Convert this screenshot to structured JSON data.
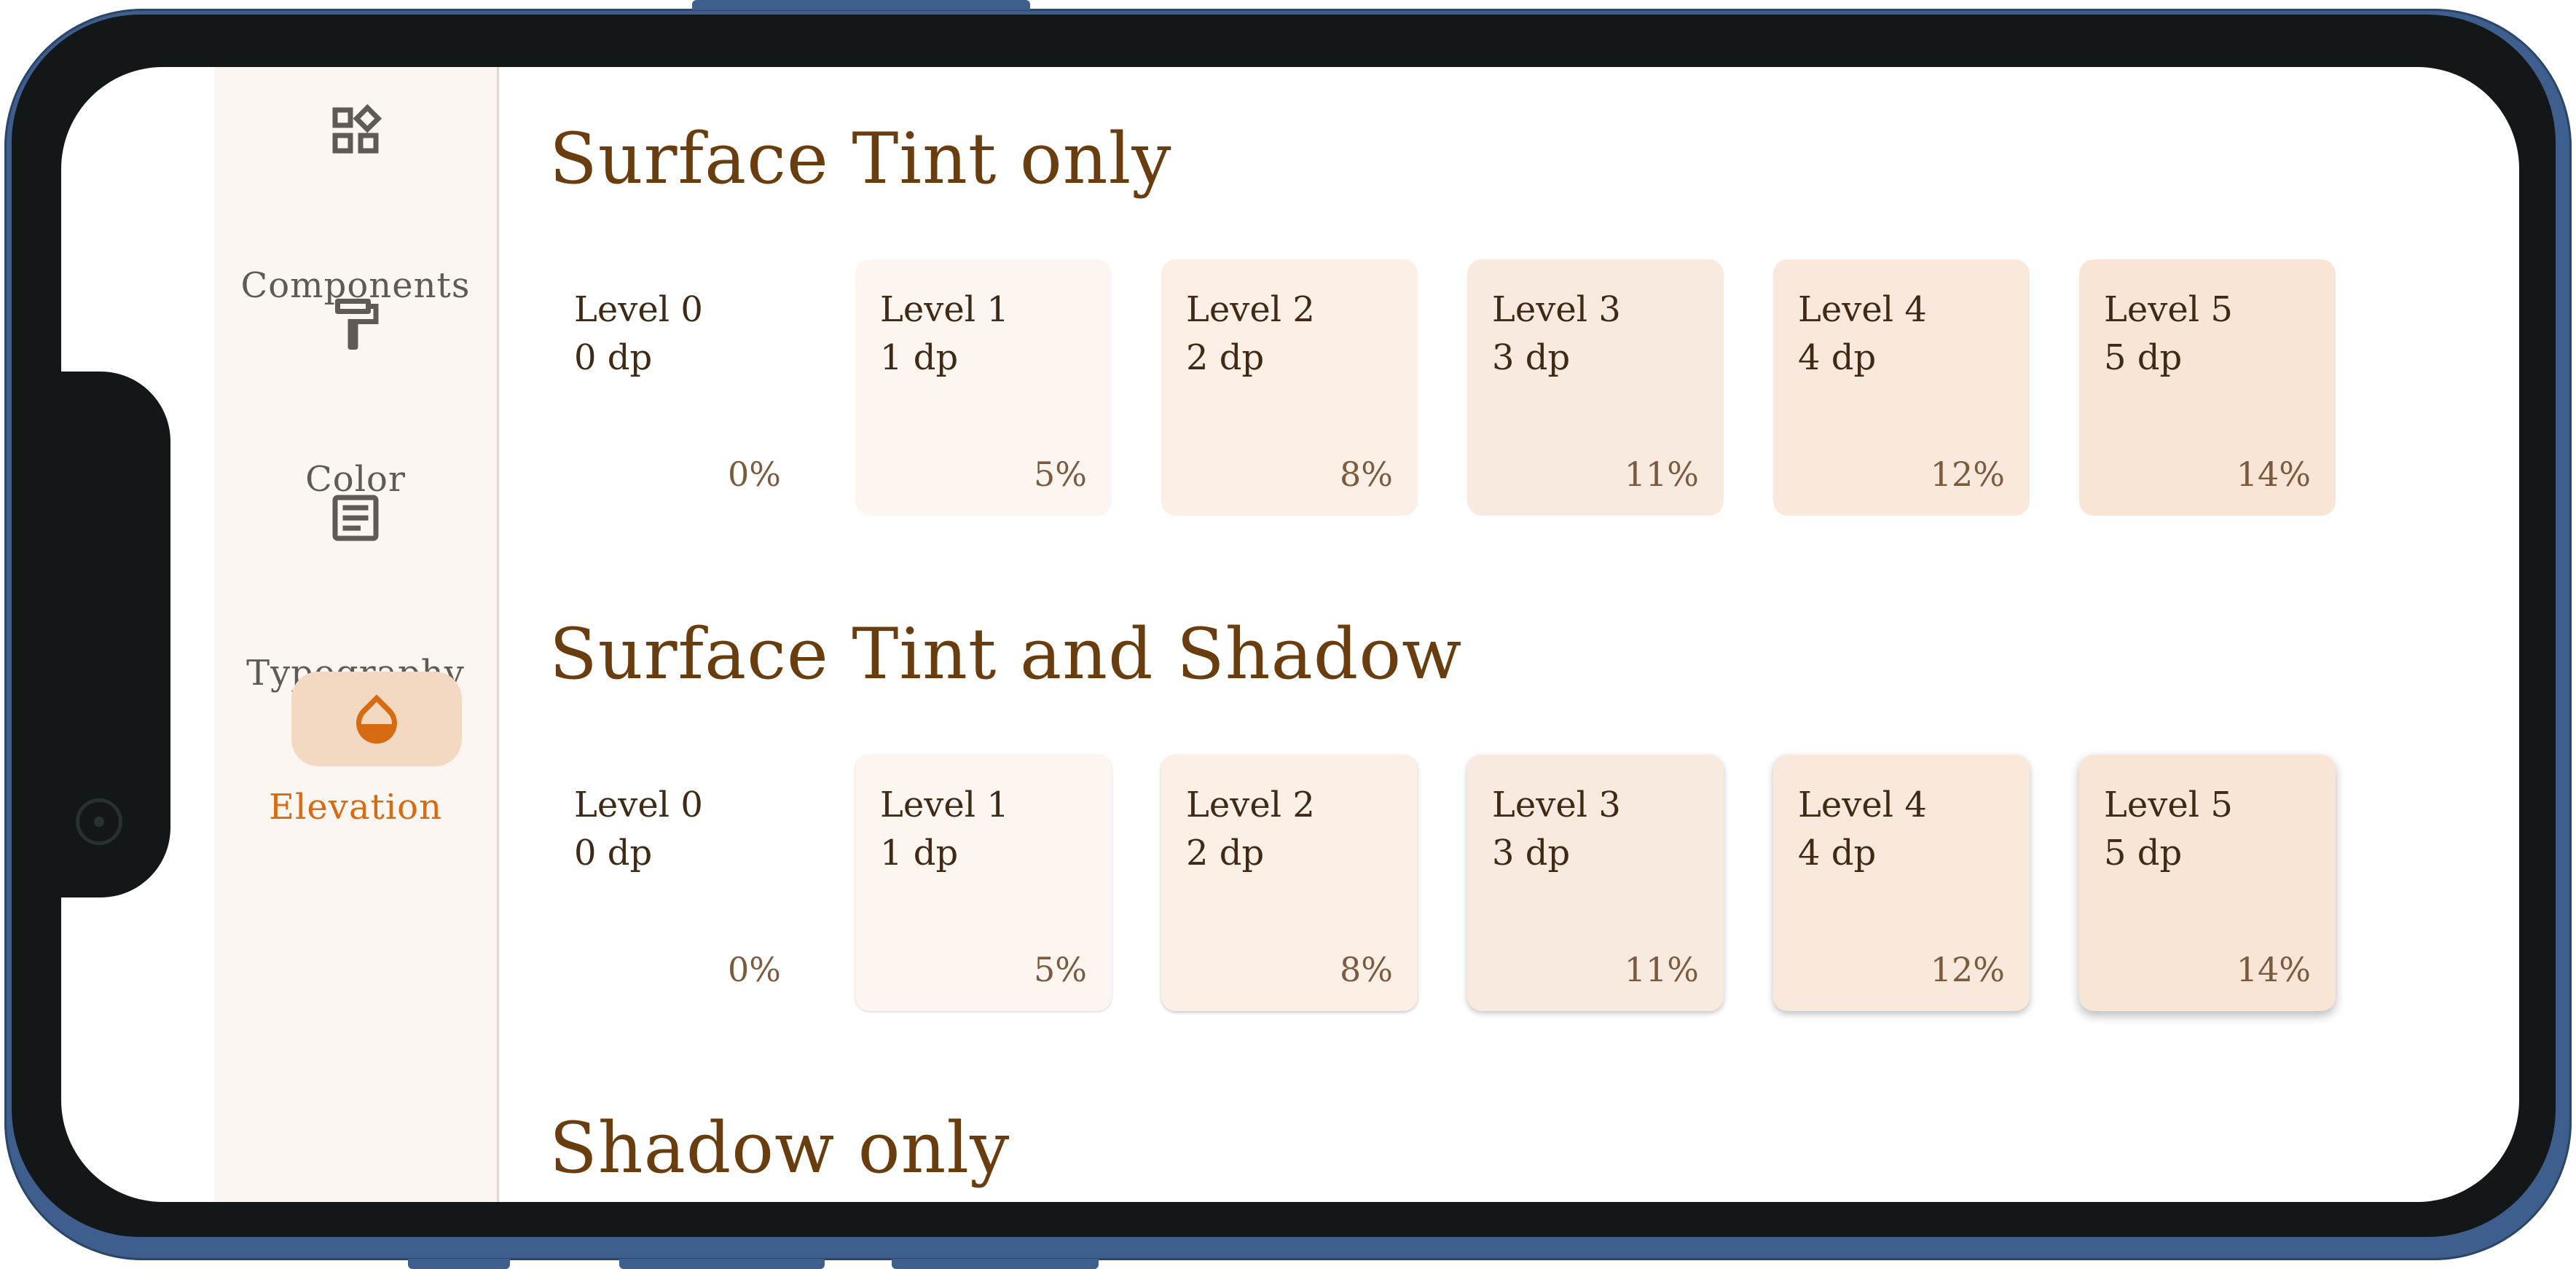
{
  "nav": {
    "items": [
      {
        "label": "Components",
        "icon": "widgets-icon",
        "active": false
      },
      {
        "label": "Color",
        "icon": "format-paint-icon",
        "active": false
      },
      {
        "label": "Typography",
        "icon": "article-icon",
        "active": false
      },
      {
        "label": "Elevation",
        "icon": "opacity-icon",
        "active": true
      }
    ]
  },
  "sections": [
    {
      "title": "Surface Tint only",
      "cards": [
        {
          "level": "Level 0",
          "dp": "0 dp",
          "pct": "0%"
        },
        {
          "level": "Level 1",
          "dp": "1 dp",
          "pct": "5%"
        },
        {
          "level": "Level 2",
          "dp": "2 dp",
          "pct": "8%"
        },
        {
          "level": "Level 3",
          "dp": "3 dp",
          "pct": "11%"
        },
        {
          "level": "Level 4",
          "dp": "4 dp",
          "pct": "12%"
        },
        {
          "level": "Level 5",
          "dp": "5 dp",
          "pct": "14%"
        }
      ]
    },
    {
      "title": "Surface Tint and Shadow",
      "cards": [
        {
          "level": "Level 0",
          "dp": "0 dp",
          "pct": "0%"
        },
        {
          "level": "Level 1",
          "dp": "1 dp",
          "pct": "5%"
        },
        {
          "level": "Level 2",
          "dp": "2 dp",
          "pct": "8%"
        },
        {
          "level": "Level 3",
          "dp": "3 dp",
          "pct": "11%"
        },
        {
          "level": "Level 4",
          "dp": "4 dp",
          "pct": "12%"
        },
        {
          "level": "Level 5",
          "dp": "5 dp",
          "pct": "14%"
        }
      ]
    },
    {
      "title": "Shadow only"
    }
  ],
  "colors": {
    "accent": "#d76b12",
    "active_indicator": "#f3d9c2",
    "title": "#6a3d0f",
    "rail_bg": "#fcf6f2",
    "tints": [
      "#ffffff",
      "#fcf5f0",
      "#fbefe6",
      "#f9eadf",
      "#f9e8dc",
      "#f8e5d6"
    ]
  }
}
